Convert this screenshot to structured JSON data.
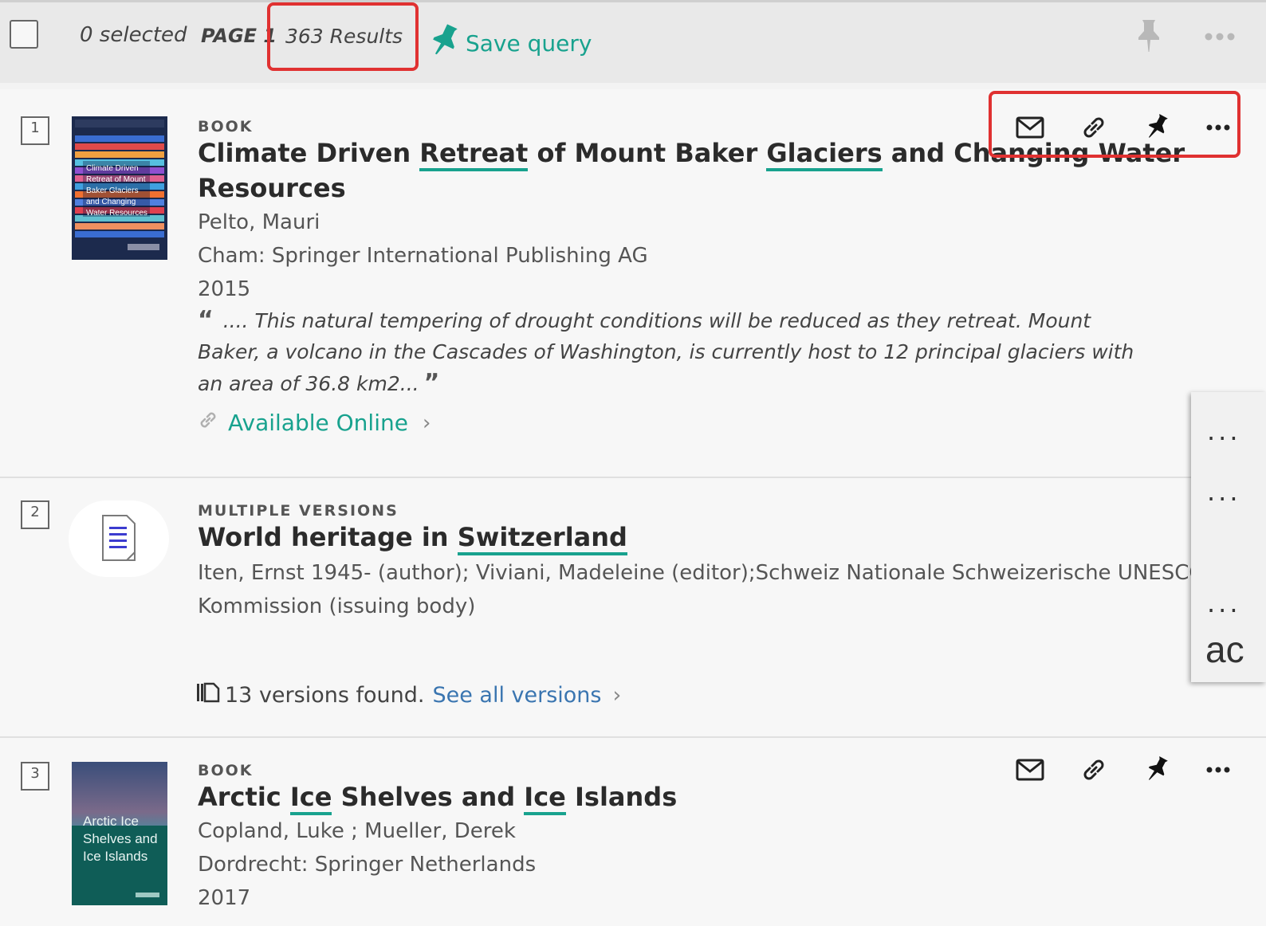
{
  "toolbar": {
    "selected": "0 selected",
    "page": "PAGE 1",
    "results": "363 Results",
    "save_query": "Save query"
  },
  "results": [
    {
      "number": "1",
      "type": "BOOK",
      "title_parts": [
        "Climate Driven ",
        "Retreat",
        " of Mount Baker ",
        "Glaciers",
        " and Changing Water"
      ],
      "title_line2": "Resources",
      "author": "Pelto, Mauri",
      "publisher": "Cham: Springer International Publishing AG",
      "year": "2015",
      "snippet": ".... This natural tempering of drought conditions will be reduced as they retreat. Mount Baker, a volcano in the Cascades of Washington, is currently host to 12 principal glaciers with an area of 36.8 km2...",
      "availability": "Available Online",
      "cover_text": "Climate Driven Retreat of Mount Baker Glaciers and Changing Water Resources"
    },
    {
      "number": "2",
      "type": "MULTIPLE VERSIONS",
      "title_parts": [
        "World heritage in ",
        "Switzerland"
      ],
      "contributors_line1": "Iten, Ernst 1945- (author); Viviani, Madeleine (editor);Schweiz Nationale Schweizerische UNESCO-",
      "contributors_line2": "Kommission (issuing body)",
      "versions_text": "13 versions found.",
      "versions_link": "See all versions"
    },
    {
      "number": "3",
      "type": "BOOK",
      "title_parts": [
        "Arctic ",
        "Ice",
        " Shelves and ",
        "Ice",
        " Islands"
      ],
      "author": "Copland, Luke ; Mueller, Derek",
      "publisher": "Dordrecht: Springer Netherlands",
      "year": "2017",
      "cover_text": "Arctic Ice Shelves and Ice Islands"
    }
  ],
  "side_panel": {
    "dots1": "...",
    "dots2": "...",
    "dots3": "...",
    "text": "ac"
  },
  "colors": {
    "accent": "#18a28e",
    "link_blue": "#3a75b0",
    "highlight": "#e03131"
  }
}
